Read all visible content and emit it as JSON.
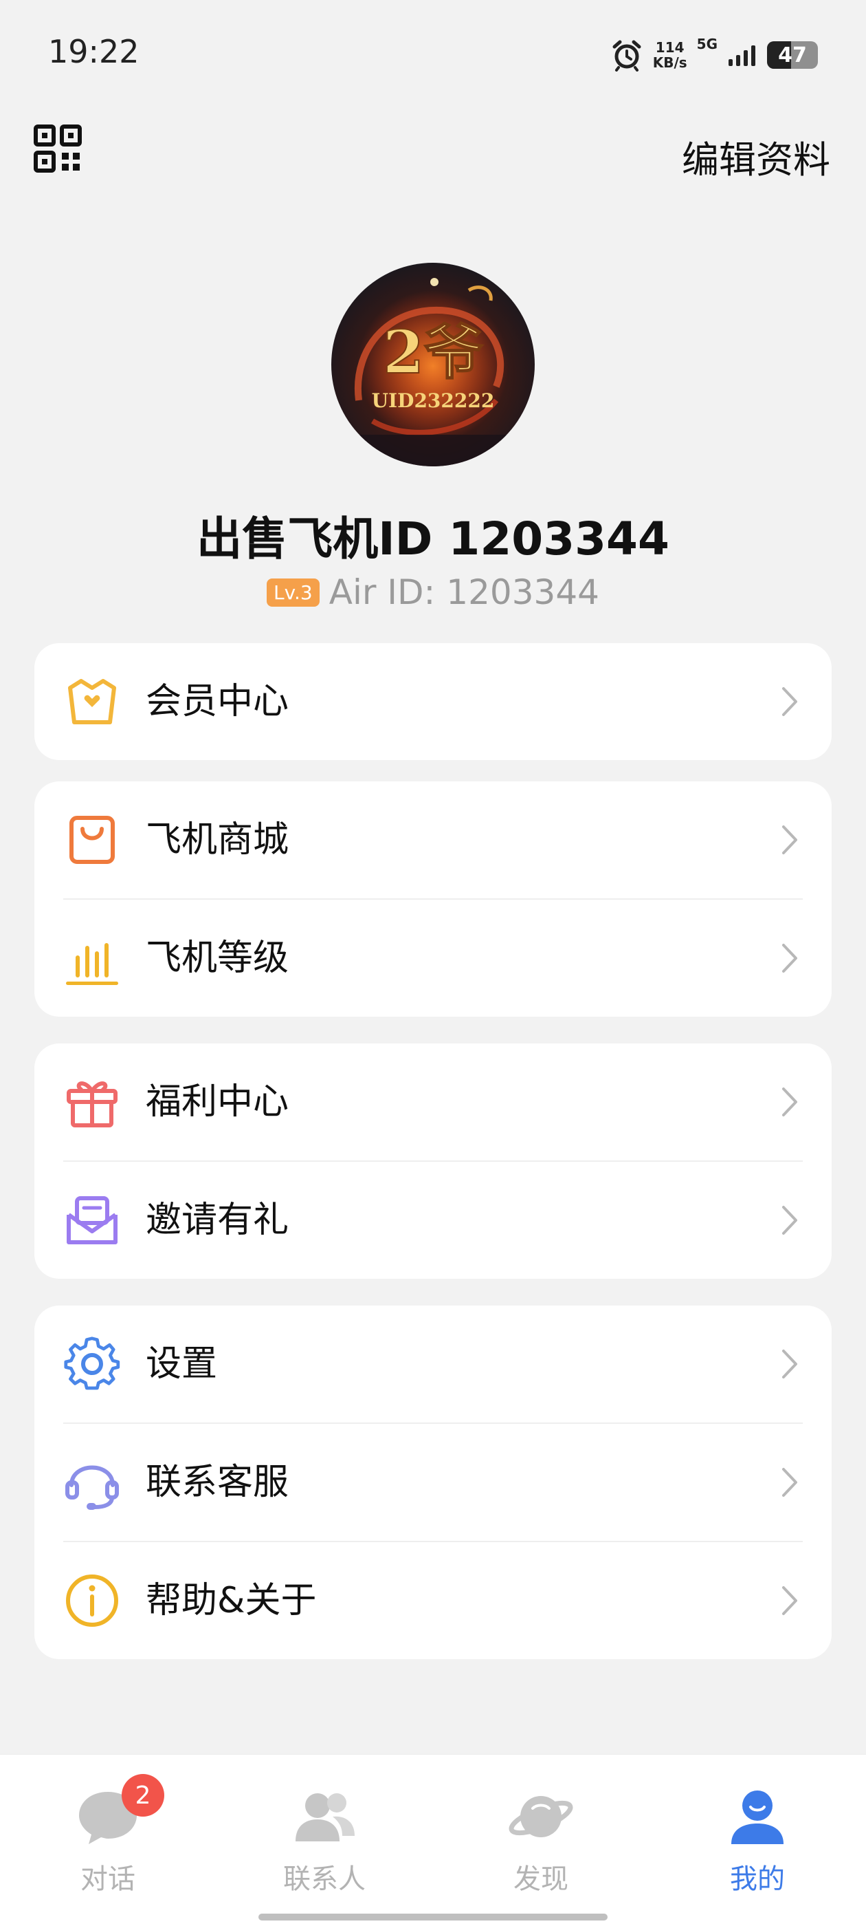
{
  "status_bar": {
    "time": "19:22",
    "speed_value": "114",
    "speed_unit": "KB/s",
    "network": "5G",
    "battery": "47"
  },
  "header": {
    "edit_profile": "编辑资料"
  },
  "profile": {
    "name": "出售飞机ID 1203344",
    "level": "Lv.3",
    "air_id": "Air ID: 1203344",
    "avatar_text": "2爷",
    "avatar_uid": "UID232222"
  },
  "menu_groups": [
    {
      "items": [
        {
          "label": "会员中心",
          "icon": "crown-icon",
          "color": "#f3b63a"
        }
      ]
    },
    {
      "items": [
        {
          "label": "飞机商城",
          "icon": "shopping-bag-icon",
          "color": "#ef7a3c"
        },
        {
          "label": "飞机等级",
          "icon": "bar-chart-icon",
          "color": "#f0b428"
        }
      ]
    },
    {
      "items": [
        {
          "label": "福利中心",
          "icon": "gift-icon",
          "color": "#ef6a6a"
        },
        {
          "label": "邀请有礼",
          "icon": "mail-invite-icon",
          "color": "#9b7cf0"
        }
      ]
    },
    {
      "items": [
        {
          "label": "设置",
          "icon": "gear-icon",
          "color": "#4a86e8"
        },
        {
          "label": "联系客服",
          "icon": "headset-icon",
          "color": "#8b8fe8"
        },
        {
          "label": "帮助&关于",
          "icon": "info-icon",
          "color": "#f0b428"
        }
      ]
    }
  ],
  "bottom_nav": [
    {
      "label": "对话",
      "icon": "chat-icon",
      "badge": "2",
      "active": false
    },
    {
      "label": "联系人",
      "icon": "contacts-icon",
      "active": false
    },
    {
      "label": "发现",
      "icon": "planet-icon",
      "active": false
    },
    {
      "label": "我的",
      "icon": "profile-icon",
      "active": true
    }
  ],
  "colors": {
    "accent": "#3d7be8",
    "background": "#f2f2f2",
    "level_badge": "#f5a04a",
    "nav_badge": "#f2544a"
  }
}
